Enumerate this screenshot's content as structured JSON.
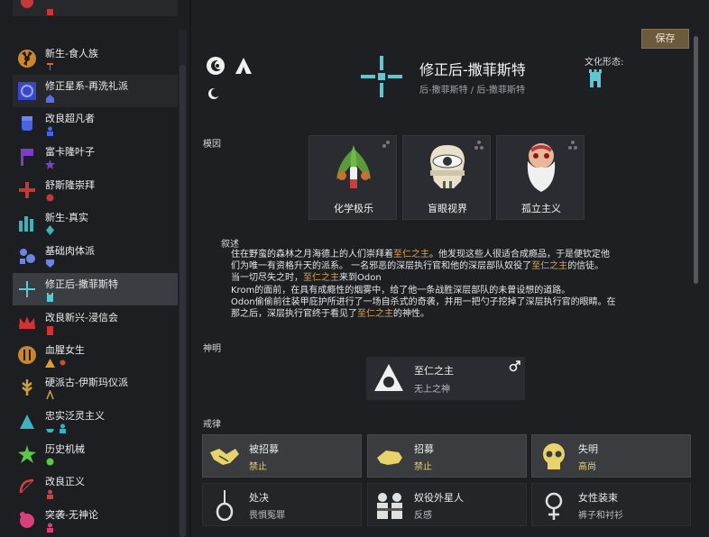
{
  "sidebar": {
    "items": [
      {
        "label": "",
        "icon": "red-skull-icon"
      },
      {
        "label": "新生-食人族",
        "icon": "radiation-icon"
      },
      {
        "label": "修正星系-再洗礼派",
        "icon": "blue-ring-icon"
      },
      {
        "label": "改良超凡者",
        "icon": "blue-fist-icon"
      },
      {
        "label": "富卡隆叶子",
        "icon": "purple-flag-icon"
      },
      {
        "label": "舒斯隆崇拜",
        "icon": "red-cross-icon"
      },
      {
        "label": "新生-真实",
        "icon": "teal-bars-icon"
      },
      {
        "label": "基础肉体派",
        "icon": "blue-body-icon"
      },
      {
        "label": "修正后-撒菲斯特",
        "icon": "cross-icon",
        "selected": true
      },
      {
        "label": "改良新兴-浸信会",
        "icon": "crown-icon"
      },
      {
        "label": "血腥女生",
        "icon": "cutlery-icon"
      },
      {
        "label": "硬派古-伊斯玛仪派",
        "icon": "wheat-icon"
      },
      {
        "label": "忠实泛灵主义",
        "icon": "spirit-icon"
      },
      {
        "label": "历史机械",
        "icon": "star-burst-icon"
      },
      {
        "label": "改良正义",
        "icon": "bow-icon"
      },
      {
        "label": "突袭-无神论",
        "icon": "pink-blob-icon"
      }
    ]
  },
  "header": {
    "save_label": "保存",
    "title": "修正后-撒菲斯特",
    "subtitle": "后-撒菲斯特 / 后-撒菲斯特",
    "form_label": "文化形态:"
  },
  "memes": {
    "label": "模因",
    "items": [
      {
        "name": "化学极乐",
        "icon": "chemical-leaves-icon"
      },
      {
        "name": "盲眼视界",
        "icon": "blind-eye-icon"
      },
      {
        "name": "孤立主义",
        "icon": "bearded-man-icon"
      }
    ]
  },
  "narrative": {
    "label": "叙述",
    "lines": [
      [
        {
          "t": "住在野蛮的森林之月海德上的人们崇拜着"
        },
        {
          "t": "至仁之主",
          "hl": true
        },
        {
          "t": "。他发现这些人很适合成瘾品，于是便钦定他"
        }
      ],
      [
        {
          "t": "们为唯一有资格升天的派系。 一名邪恶的深层执行官和他的深层部队奴役了"
        },
        {
          "t": "至仁之主",
          "hl": true
        },
        {
          "t": "的信徒。"
        }
      ],
      [
        {
          "t": "当一切尽失之时，"
        },
        {
          "t": "至仁之主",
          "hl": true
        },
        {
          "t": "来到Odon"
        }
      ],
      [
        {
          "t": "Krom的面前，在具有成瘾性的烟雾中，给了他一条战胜深层部队的未曾设想的道路。"
        }
      ],
      [
        {
          "t": "Odon偷偷前往装甲庇护所进行了一场自杀式的奇袭，并用一把勺子挖掉了深层执行官的眼睛。在"
        }
      ],
      [
        {
          "t": "那之后，深层执行官终于看见了"
        },
        {
          "t": "至仁之主",
          "hl": true
        },
        {
          "t": "的神性。"
        }
      ]
    ]
  },
  "deity": {
    "label": "神明",
    "name": "至仁之主",
    "title": "无上之神",
    "gender_icon": "male-icon"
  },
  "precepts": {
    "label": "戒律",
    "items": [
      {
        "name": "被招募",
        "value": "禁止",
        "icon": "handshake-icon",
        "value_color": "#e8d36a"
      },
      {
        "name": "招募",
        "value": "禁止",
        "icon": "hand-icon",
        "value_color": "#e8d36a"
      },
      {
        "name": "失明",
        "value": "高尚",
        "icon": "yellow-skull-icon",
        "value_color": "#e8d36a"
      },
      {
        "name": "处决",
        "value": "畏惧冤罪",
        "icon": "noose-icon",
        "value_color": "#b8bcc2"
      },
      {
        "name": "奴役外星人",
        "value": "反感",
        "icon": "prisoners-icon",
        "value_color": "#b8bcc2"
      },
      {
        "name": "女性装束",
        "value": "裤子和衬衫",
        "icon": "female-icon",
        "value_color": "#b8bcc2"
      }
    ]
  },
  "colors": {
    "accent_teal": "#5fc7cf",
    "highlight_gold": "#d6a55a",
    "save_bg": "#6b5a3c"
  }
}
